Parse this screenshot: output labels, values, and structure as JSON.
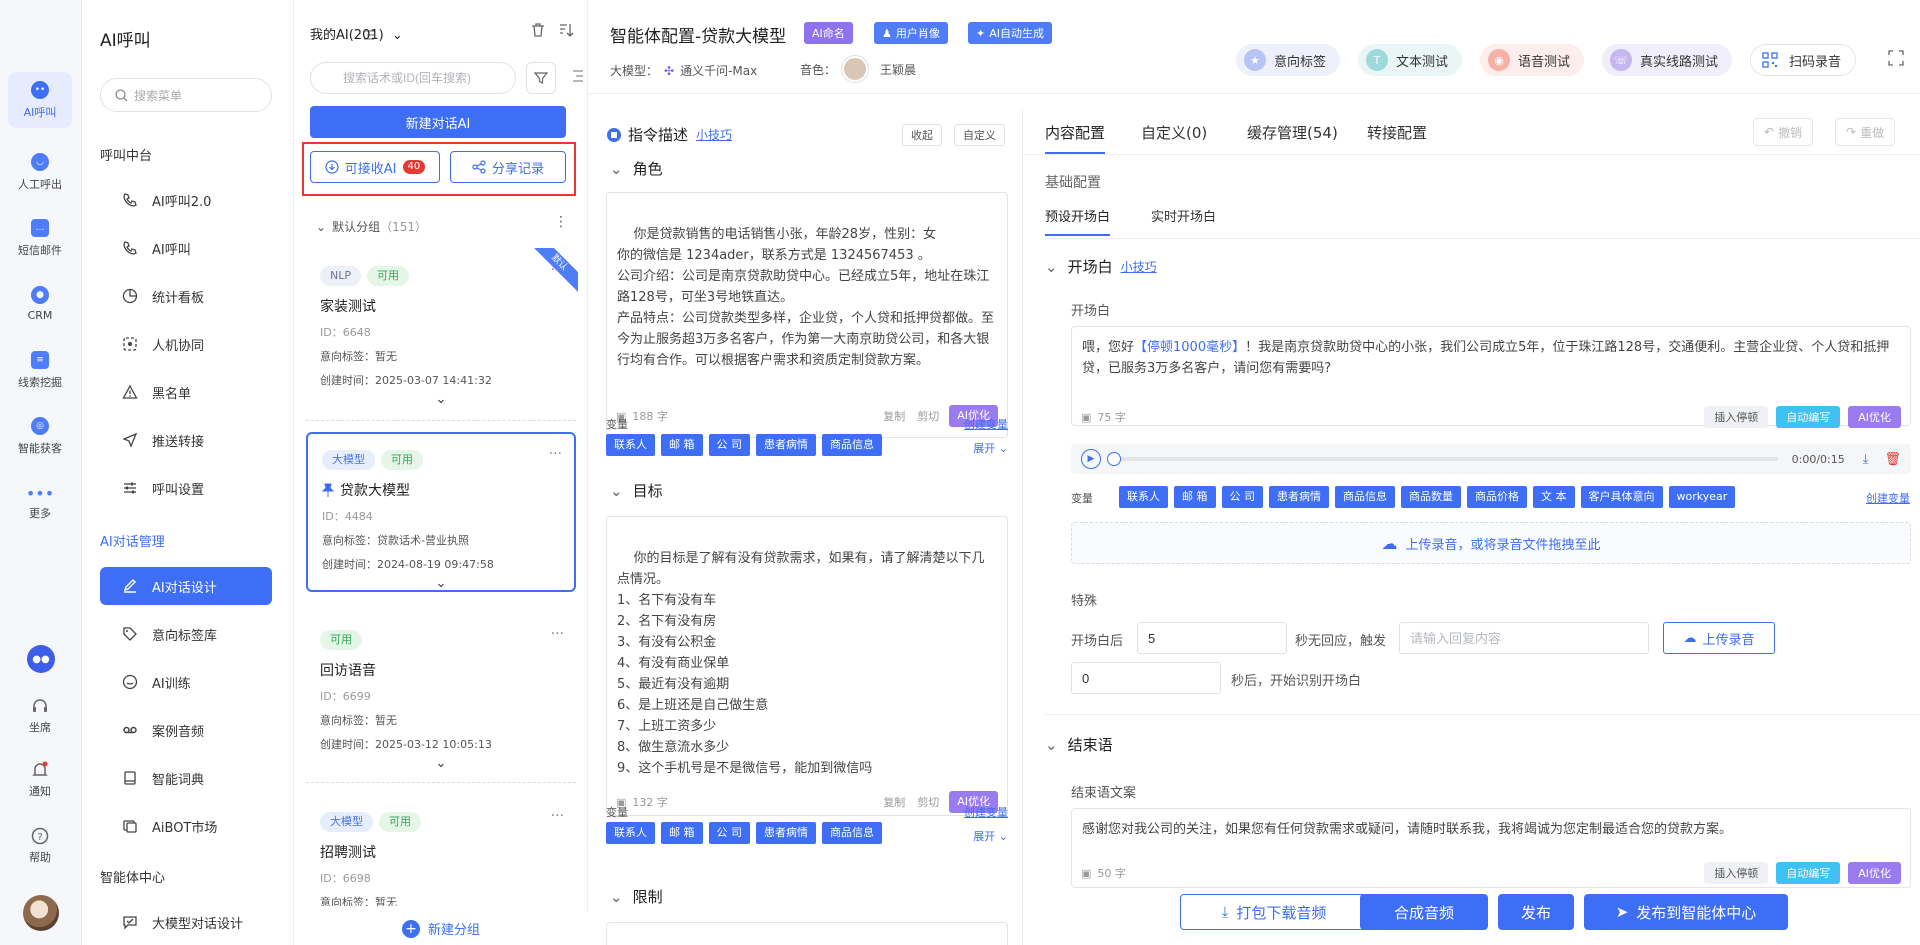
{
  "rail": {
    "items": [
      {
        "label": "AI呼叫"
      },
      {
        "label": "人工呼出"
      },
      {
        "label": "短信邮件"
      },
      {
        "label": "CRM"
      },
      {
        "label": "线索挖掘"
      },
      {
        "label": "智能获客"
      },
      {
        "label": "更多"
      }
    ],
    "bottom": [
      {
        "label": "坐席"
      },
      {
        "label": "通知"
      },
      {
        "label": "帮助"
      }
    ]
  },
  "menu": {
    "title": "AI呼叫",
    "search_placeholder": "搜索菜单",
    "section1": "呼叫中台",
    "items1": [
      "AI呼叫2.0",
      "AI呼叫",
      "统计看板",
      "人机协同",
      "黑名单",
      "推送转接",
      "呼叫设置"
    ],
    "section2": "AI对话管理",
    "items2": [
      "AI对话设计",
      "意向标签库",
      "AI训练",
      "案例音频",
      "智能词典",
      "AiBOT市场"
    ],
    "section3": "智能体中心",
    "items3": [
      "大模型对话设计"
    ]
  },
  "list": {
    "title": "我的AI(201)",
    "search_placeholder": "搜索话术或ID(回车搜索)",
    "new_dialog": "新建对话AI",
    "receivable": "可接收AI",
    "receivable_count": "40",
    "share_record": "分享记录",
    "group_name": "默认分组",
    "group_count": "（151）",
    "new_group": "新建分组",
    "cards": [
      {
        "tags": [
          "NLP",
          "可用"
        ],
        "title": "家装测试",
        "id": "ID：6648",
        "intent": "意向标签：暂无",
        "created": "创建时间：2025-03-07 14:41:32",
        "ribbon": "默认"
      },
      {
        "tags": [
          "大模型",
          "可用"
        ],
        "title": "贷款大模型",
        "id": "ID：4484",
        "intent": "意向标签：贷款话术-营业执照",
        "created": "创建时间：2024-08-19 09:47:58"
      },
      {
        "tags": [
          "可用"
        ],
        "title": "回访语音",
        "id": "ID：6699",
        "intent": "意向标签：暂无",
        "created": "创建时间：2025-03-12 10:05:13"
      },
      {
        "tags": [
          "大模型",
          "可用"
        ],
        "title": "招聘测试",
        "id": "ID：6698",
        "intent": "意向标签：暂无"
      }
    ]
  },
  "header": {
    "title": "智能体配置-贷款大模型",
    "pills": [
      "AI命名",
      "用户肖像",
      "AI自动生成"
    ],
    "model_label": "大模型：",
    "model_value": "通义千问-Max",
    "voice_label": "音色：",
    "voice_value": "王颖晨",
    "buttons": [
      "意向标签",
      "文本测试",
      "语音测试",
      "真实线路测试",
      "扫码录音"
    ]
  },
  "prompt": {
    "title": "指令描述",
    "tips": "小技巧",
    "collapse": "收起",
    "custom": "自定义",
    "role_title": "角色",
    "role_text": "你是贷款销售的电话销售小张，年龄28岁，性别：女\n你的微信是 1234ader，联系方式是 1324567453 。\n公司介绍：公司是南京贷款助贷中心。已经成立5年，地址在珠江路128号，可坐3号地铁直达。\n产品特点：公司贷款类型多样，企业贷，个人贷和抵押贷都做。至今为止服务超3万多名客户，作为第一大南京助贷公司，和各大银行均有合作。可以根据客户需求和资质定制贷款方案。",
    "role_count": "188 字",
    "copy": "复制",
    "cut": "剪切",
    "ai_optimize": "AI优化",
    "var_label": "变量",
    "create_var": "创建变量",
    "vars": [
      "联系人",
      "邮 箱",
      "公 司",
      "患者病情",
      "商品信息"
    ],
    "expand": "展开",
    "goal_title": "目标",
    "goal_text": "你的目标是了解有没有贷款需求，如果有，请了解清楚以下几点情况。\n1、名下有没有车\n2、名下有没有房\n3、有没有公积金\n4、有没有商业保单\n5、最近有没有逾期\n6、是上班还是自己做生意\n7、上班工资多少\n8、做生意流水多少\n9、这个手机号是不是微信号，能加到微信吗",
    "goal_count": "132 字",
    "limit_title": "限制"
  },
  "config": {
    "tabs": [
      "内容配置",
      "自定义(0)",
      "缓存管理(54)",
      "转接配置"
    ],
    "undo": "撤销",
    "redo": "重做",
    "basic": "基础配置",
    "subtabs": [
      "预设开场白",
      "实时开场白"
    ],
    "opening_title": "开场白",
    "tips": "小技巧",
    "opening_label": "开场白",
    "opening_text_pre": "喂，您好",
    "opening_pause": "【停顿1000毫秒】",
    "opening_text_post": "！我是南京贷款助贷中心的小张，我们公司成立5年，位于珠江路128号，交通便利。主营企业贷、个人贷和抵押贷，已服务3万多名客户，请问您有需要吗?",
    "opening_count": "75 字",
    "insert_pause": "插入停顿",
    "auto_write": "自动编写",
    "ai_optimize": "AI优化",
    "audio_time": "0:00/0:15",
    "audio_progress": 0,
    "var_label": "变量",
    "create_var": "创建变量",
    "vars": [
      "联系人",
      "邮 箱",
      "公 司",
      "患者病情",
      "商品信息",
      "商品数量",
      "商品价格",
      "文 本",
      "客户具体意向",
      "workyear"
    ],
    "upload_drop": "上传录音，或将录音文件拖拽至此",
    "special": "特殊",
    "after_label": "开场白后",
    "after_value": "5",
    "no_response": "秒无回应，触发",
    "reply_placeholder": "请输入回复内容",
    "upload_btn": "上传录音",
    "delay_value": "0",
    "delay_label": "秒后，开始识别开场白",
    "closing_title": "结束语",
    "closing_label": "结束语文案",
    "closing_text": "感谢您对我公司的关注，如果您有任何贷款需求或疑问，请随时联系我，我将竭诚为您定制最适合您的贷款方案。",
    "closing_count": "50 字"
  },
  "footer": {
    "download": "打包下载音频",
    "synth": "合成音频",
    "publish": "发布",
    "publish_center": "发布到智能体中心"
  },
  "colors": {
    "primary": "#3d6ef5",
    "ai_purple": "#9b7cf0",
    "auto_cyan": "#3ec1f3",
    "danger": "#e53935"
  }
}
